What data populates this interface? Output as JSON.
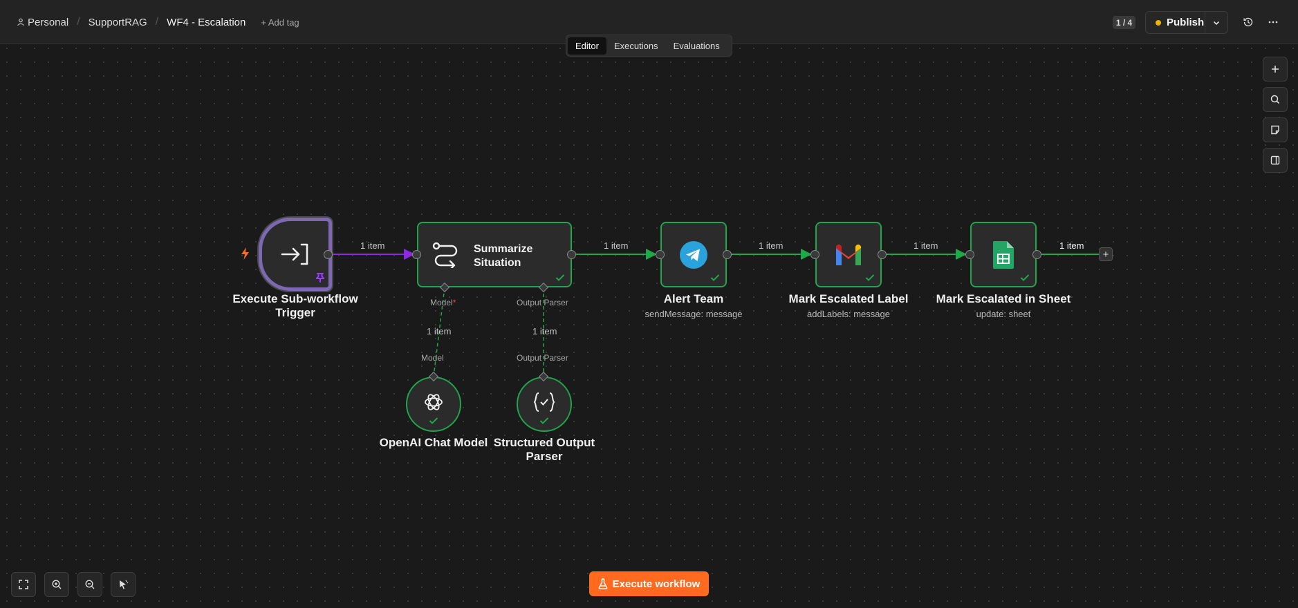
{
  "header": {
    "breadcrumbs": [
      "Personal",
      "SupportRAG",
      "WF4 - Escalation"
    ],
    "add_tag": "+ Add tag",
    "version_counter": "1 / 4",
    "publish_label": "Publish",
    "publish_status_color": "#f0b400"
  },
  "tabs": [
    {
      "label": "Editor",
      "active": true
    },
    {
      "label": "Executions",
      "active": false
    },
    {
      "label": "Evaluations",
      "active": false
    }
  ],
  "canvas_controls": [
    "zoom-in-plus-icon",
    "search-icon",
    "sticky-note-icon",
    "panel-toggle-icon"
  ],
  "bottom_controls": [
    "fit-view-icon",
    "zoom-in-icon",
    "zoom-out-icon",
    "tidy-up-icon"
  ],
  "execute_label": "Execute workflow",
  "colors": {
    "success": "#1fa74a",
    "trigger_border": "#7d68b3",
    "trigger_edge": "#8a2be2",
    "execute": "#ff6a1f"
  },
  "nodes": {
    "trigger": {
      "label": "Execute Sub-workflow Trigger"
    },
    "summarize": {
      "label": "Summarize Situation"
    },
    "alert": {
      "label": "Alert Team",
      "sub": "sendMessage: message"
    },
    "gmail": {
      "label": "Mark Escalated Label",
      "sub": "addLabels: message"
    },
    "sheets": {
      "label": "Mark Escalated in Sheet",
      "sub": "update: sheet"
    },
    "openai": {
      "label": "OpenAI Chat Model"
    },
    "parser": {
      "label": "Structured Output Parser"
    }
  },
  "edges": {
    "trigger_summarize": "1 item",
    "summarize_alert": "1 item",
    "alert_gmail": "1 item",
    "gmail_sheets": "1 item",
    "sheets_out": "1 item",
    "model_link": "1 item",
    "parser_link": "1 item"
  },
  "ports": {
    "model_top": "Model",
    "model_required": "*",
    "parser_top": "Output Parser",
    "model_bottom": "Model",
    "parser_bottom": "Output Parser"
  }
}
